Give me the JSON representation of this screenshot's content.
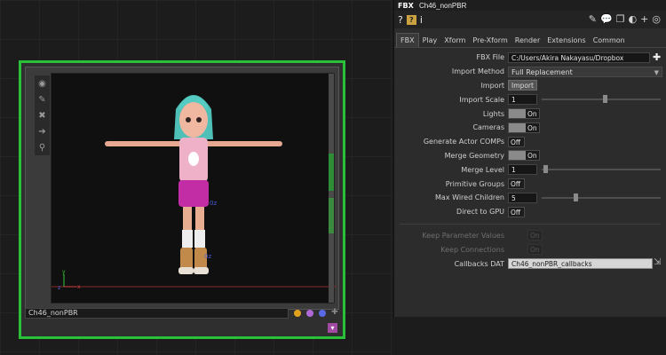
{
  "node": {
    "name": "Ch46_nonPBR",
    "toolbar_icons": [
      "circle-target-icon",
      "edit-pen-icon",
      "close-x-icon",
      "arrow-right-icon",
      "pin-icon"
    ],
    "flag_colors": [
      "#e0a020",
      "#b06ad8",
      "#5a6ae6"
    ],
    "viewport_labels": {
      "axis_y": "y",
      "axis_x": "x",
      "axis_z": "z",
      "marker_a": "0z",
      "marker_b": "0z"
    },
    "viewer_button": "▾"
  },
  "panel": {
    "op_type": "FBX",
    "op_name": "Ch46_nonPBR",
    "tabs": [
      "FBX",
      "Play",
      "Xform",
      "Pre-Xform",
      "Render",
      "Extensions",
      "Common"
    ],
    "active_tab": "FBX",
    "params": {
      "fbx_file": {
        "label": "FBX File",
        "value": "C:/Users/Akira Nakayasu/Dropbox"
      },
      "import_method": {
        "label": "Import Method",
        "value": "Full Replacement"
      },
      "import": {
        "label": "Import",
        "button": "Import"
      },
      "import_scale": {
        "label": "Import Scale",
        "value": "1",
        "slider": 0.55
      },
      "lights": {
        "label": "Lights",
        "value": "On"
      },
      "cameras": {
        "label": "Cameras",
        "value": "On"
      },
      "generate_actor_comps": {
        "label": "Generate Actor COMPs",
        "value": "Off"
      },
      "merge_geometry": {
        "label": "Merge Geometry",
        "value": "On"
      },
      "merge_level": {
        "label": "Merge Level",
        "value": "1",
        "slider": 0.0
      },
      "primitive_groups": {
        "label": "Primitive Groups",
        "value": "Off"
      },
      "max_wired_children": {
        "label": "Max Wired Children",
        "value": "5",
        "slider": 0.25
      },
      "direct_to_gpu": {
        "label": "Direct to GPU",
        "value": "Off"
      },
      "keep_parameter_values": {
        "label": "Keep Parameter Values",
        "value": "On"
      },
      "keep_connections": {
        "label": "Keep Connections",
        "value": "On"
      },
      "callbacks_dat": {
        "label": "Callbacks DAT",
        "value": "Ch46_nonPBR_callbacks"
      }
    }
  }
}
